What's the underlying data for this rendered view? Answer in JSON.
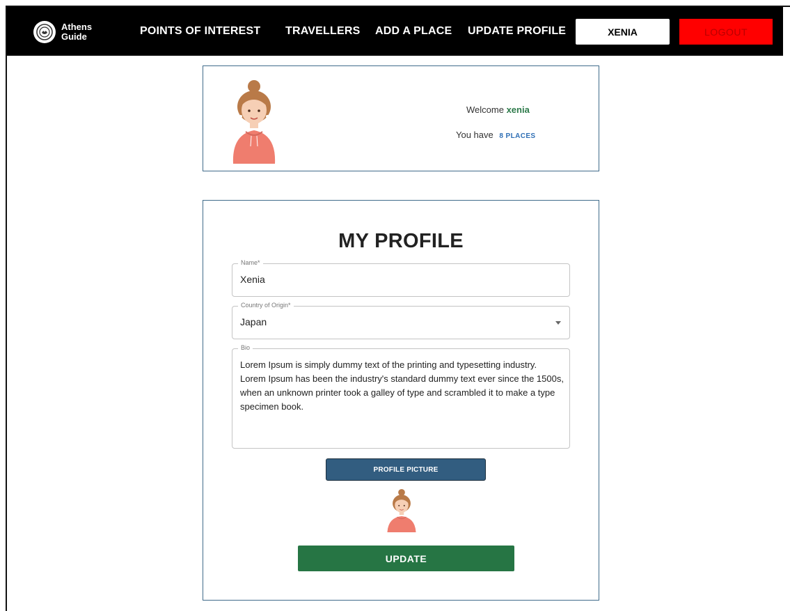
{
  "nav": {
    "logo_line1": "Athens",
    "logo_line2": "Guide",
    "links": [
      "POINTS OF INTEREST",
      "TRAVELLERS",
      "ADD A PLACE",
      "UPDATE PROFILE"
    ],
    "user_button": "XENIA",
    "logout_button": "LOGOUT"
  },
  "welcome": {
    "greeting": "Welcome",
    "username": "xenia",
    "places_prefix": "You have",
    "places_link": "8 PLACES"
  },
  "profile": {
    "title": "MY PROFILE",
    "name_label": "Name*",
    "name_value": "Xenia",
    "country_label": "Country of Origin*",
    "country_value": "Japan",
    "bio_label": "Bio",
    "bio_value": "Lorem Ipsum is simply dummy text of the printing and typesetting industry. Lorem Ipsum has been the industry's standard dummy text ever since the 1500s, when an unknown printer took a galley of type and scrambled it to make a type specimen book.",
    "picture_button": "PROFILE PICTURE",
    "update_button": "UPDATE"
  },
  "colors": {
    "navbar": "#000000",
    "logout": "#ff0000",
    "card_border": "#3f6b8a",
    "username": "#2d7a4a",
    "places_link": "#2f6fb5",
    "picture_button": "#325d80",
    "update_button": "#267544",
    "avatar_hoodie": "#ef7d6e"
  }
}
